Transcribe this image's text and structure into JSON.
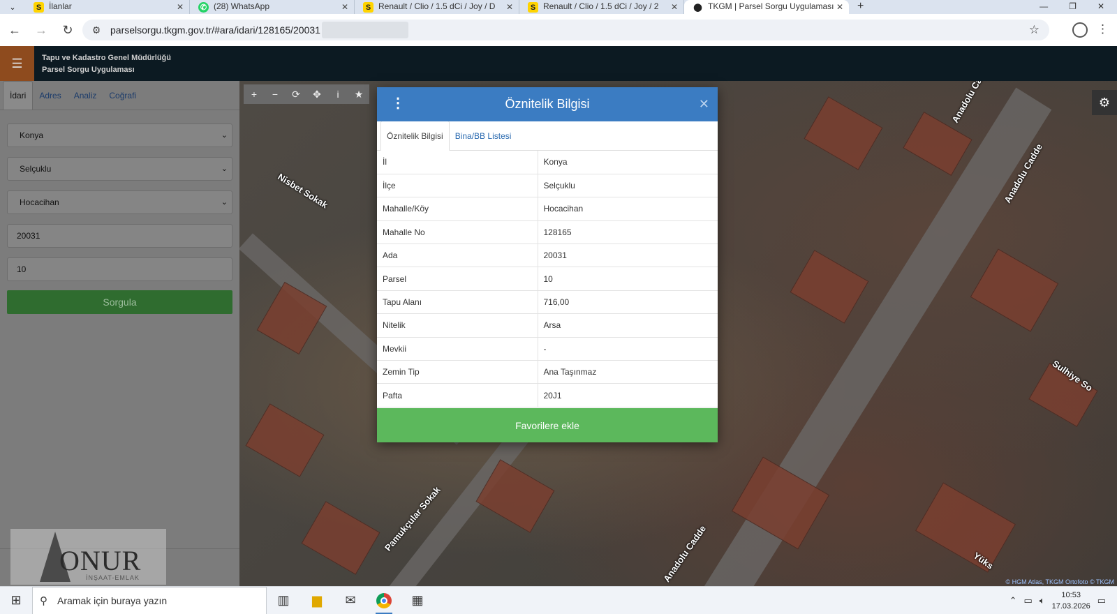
{
  "browser": {
    "tabs": [
      {
        "title": "İlanlar",
        "favicon": "S"
      },
      {
        "title": "(28) WhatsApp",
        "favicon": "whatsapp"
      },
      {
        "title": "Renault / Clio / 1.5 dCi / Joy / D",
        "favicon": "S"
      },
      {
        "title": "Renault / Clio / 1.5 dCi / Joy / 2",
        "favicon": "S"
      },
      {
        "title": "TKGM | Parsel Sorgu Uygulaması",
        "favicon": "map-pin"
      }
    ],
    "url": "parselsorgu.tkgm.gov.tr/#ara/idari/128165/20031"
  },
  "app": {
    "title_line1": "Tapu ve Kadastro Genel Müdürlüğü",
    "title_line2": "Parsel Sorgu Uygulaması"
  },
  "left_panel": {
    "tabs": [
      "İdari",
      "Adres",
      "Analiz",
      "Coğrafi"
    ],
    "il": "Konya",
    "ilce": "Selçuklu",
    "mahalle": "Hocacihan",
    "ada": "20031",
    "parsel": "10",
    "submit_label": "Sorgula"
  },
  "map": {
    "street_labels": [
      "Nisbet Sokak",
      "Anadolu Cadde",
      "Anadolu Cadde",
      "Pamukçular Sokak",
      "Sulhiye So",
      "Yüks",
      "Anadolu Cadde"
    ],
    "attribution": "© HGM Atlas, TKGM Ortofoto © TKGM"
  },
  "modal": {
    "title": "Öznitelik Bilgisi",
    "tabs": [
      "Öznitelik Bilgisi",
      "Bina/BB Listesi"
    ],
    "rows": [
      {
        "key": "İl",
        "value": "Konya"
      },
      {
        "key": "İlçe",
        "value": "Selçuklu"
      },
      {
        "key": "Mahalle/Köy",
        "value": "Hocacihan"
      },
      {
        "key": "Mahalle No",
        "value": "128165"
      },
      {
        "key": "Ada",
        "value": "20031"
      },
      {
        "key": "Parsel",
        "value": "10"
      },
      {
        "key": "Tapu Alanı",
        "value": "716,00"
      },
      {
        "key": "Nitelik",
        "value": "Arsa"
      },
      {
        "key": "Mevkii",
        "value": "-"
      },
      {
        "key": "Zemin Tip",
        "value": "Ana Taşınmaz"
      },
      {
        "key": "Pafta",
        "value": "20J1"
      }
    ],
    "favorite_label": "Favorilere ekle"
  },
  "watermark": {
    "brand": "ONUR",
    "sub": "İNŞAAT-EMLAK"
  },
  "taskbar": {
    "search_placeholder": "Aramak için buraya yazın",
    "time": "10:53",
    "date": "17.03.2026"
  }
}
